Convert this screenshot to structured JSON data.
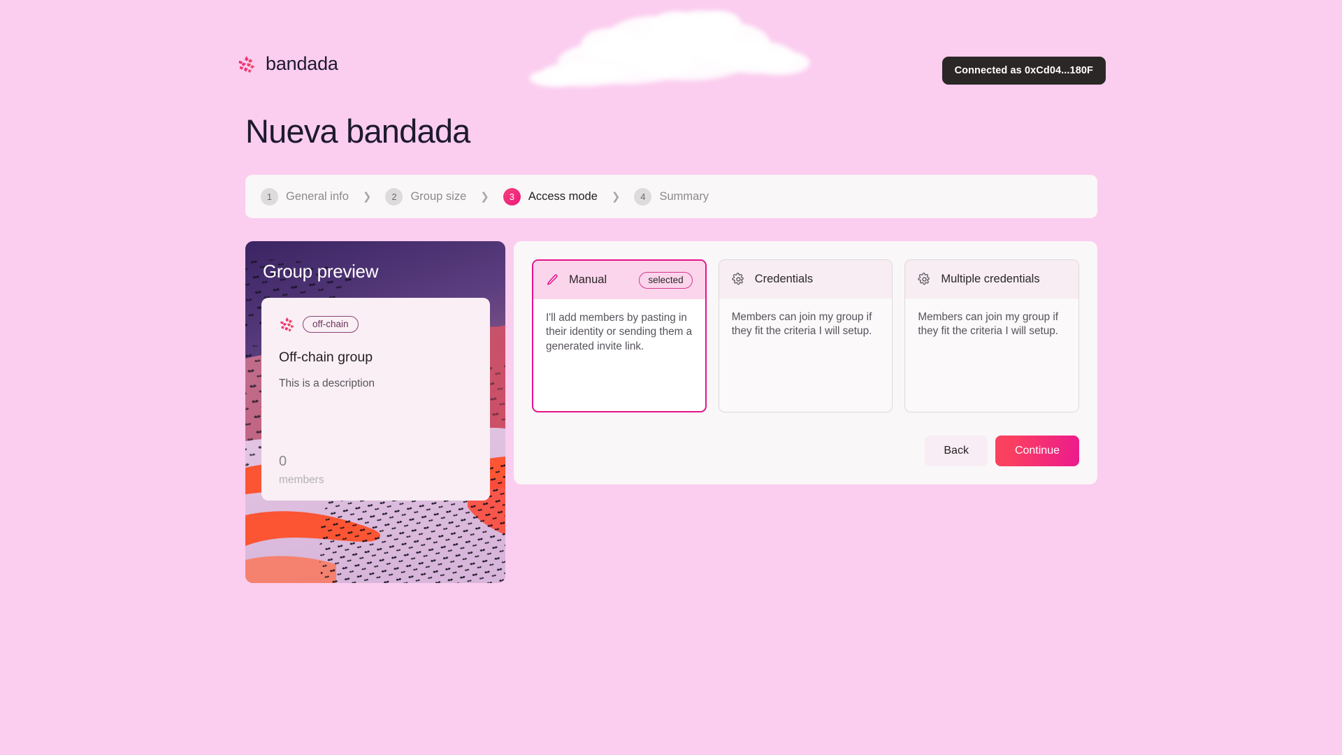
{
  "theme": {
    "background": "#FBCDEF",
    "panel": "#FAF7F8",
    "accent_pink": "#EC1A8E",
    "accent_red": "#F9455C",
    "text_dark": "#231F20",
    "text_muted": "#8C8A8B"
  },
  "header": {
    "brand_name": "bandada",
    "brand_mark_icon": "bandada-flock-logo-icon",
    "cloud_icon": "cloud-decoration-icon",
    "wallet_badge": "Connected as 0xCd04...180F"
  },
  "page": {
    "title": "Nueva bandada"
  },
  "stepper": {
    "separator": "❯",
    "steps": [
      {
        "num": "1",
        "label": "General info",
        "active": false
      },
      {
        "num": "2",
        "label": "Group size",
        "active": false
      },
      {
        "num": "3",
        "label": "Access mode",
        "active": true
      },
      {
        "num": "4",
        "label": "Summary",
        "active": false
      }
    ]
  },
  "preview": {
    "title": "Group preview",
    "logo_icon": "bandada-flock-logo-icon",
    "chain_badge": "off-chain",
    "group_name": "Off-chain group",
    "description": "This is a description",
    "members_count": "0",
    "members_label": "members"
  },
  "access_modes": {
    "cards": [
      {
        "icon": "pencil-icon",
        "title": "Manual",
        "badge": "selected",
        "selected": true,
        "description": "I'll add members by pasting in their identity or sending them a generated invite link."
      },
      {
        "icon": "gear-icon",
        "title": "Credentials",
        "badge": "",
        "selected": false,
        "description": "Members can join my group if they fit the criteria I will setup."
      },
      {
        "icon": "gear-icon",
        "title": "Multiple credentials",
        "badge": "",
        "selected": false,
        "description": "Members can join my group if they fit the criteria I will setup."
      }
    ]
  },
  "actions": {
    "back_label": "Back",
    "continue_label": "Continue"
  }
}
